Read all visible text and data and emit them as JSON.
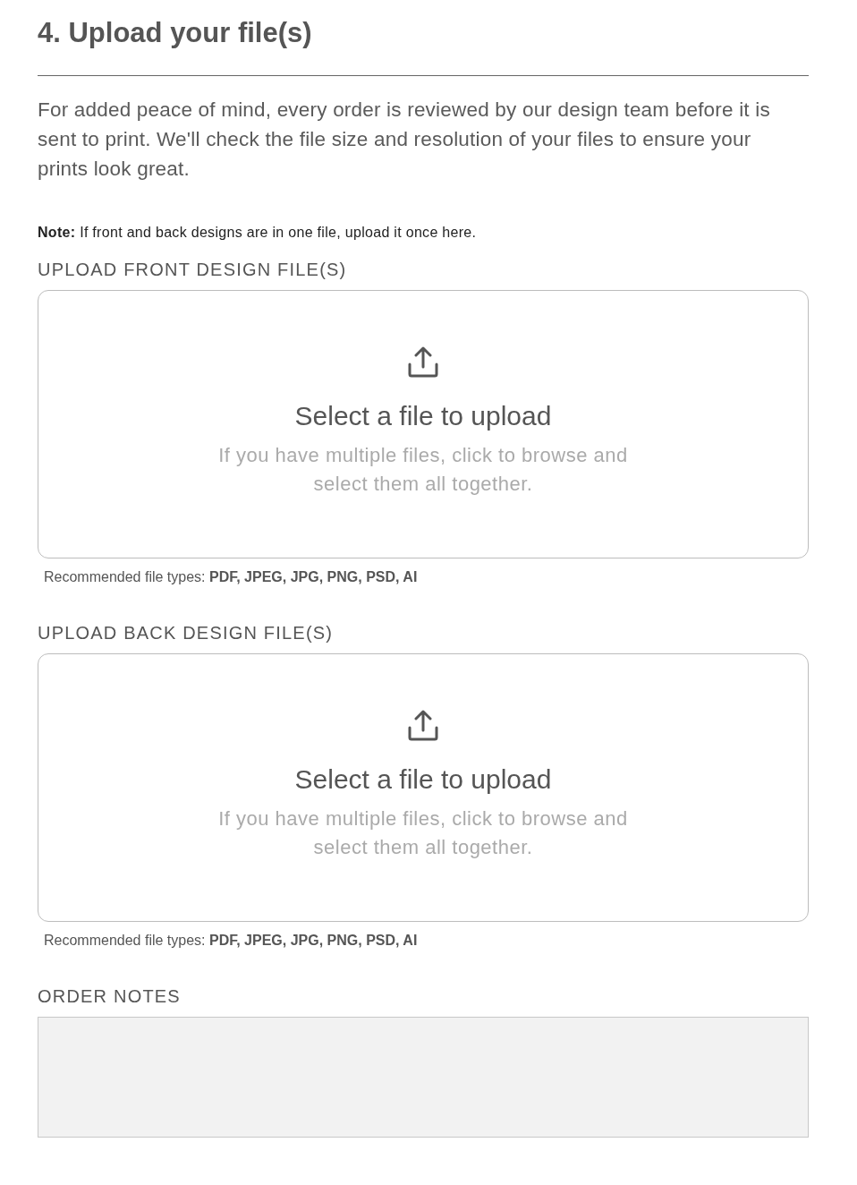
{
  "section": {
    "title": "4. Upload your file(s)",
    "intro": "For added peace of mind, every order is reviewed by our design team before it is sent to print. We'll check the file size and resolution of your files to ensure your prints look great.",
    "note": "**Note:** If front and back designs are in one file, upload it once here."
  },
  "uploads": [
    {
      "label": "UPLOAD FRONT DESIGN FILE(S)",
      "dropzone": {
        "title": "Select a file to upload",
        "hint": "If you have multiple files, click to browse and select them all together."
      },
      "file_types": "Recommended file types: **PDF, JPEG, JPG, PNG, PSD, AI**"
    },
    {
      "label": "UPLOAD BACK DESIGN FILE(S)",
      "dropzone": {
        "title": "Select a file to upload",
        "hint": "If you have multiple files, click to browse and select them all together."
      },
      "file_types": "Recommended file types: **PDF, JPEG, JPG, PNG, PSD, AI**"
    }
  ],
  "order_notes": {
    "label": "ORDER NOTES"
  }
}
